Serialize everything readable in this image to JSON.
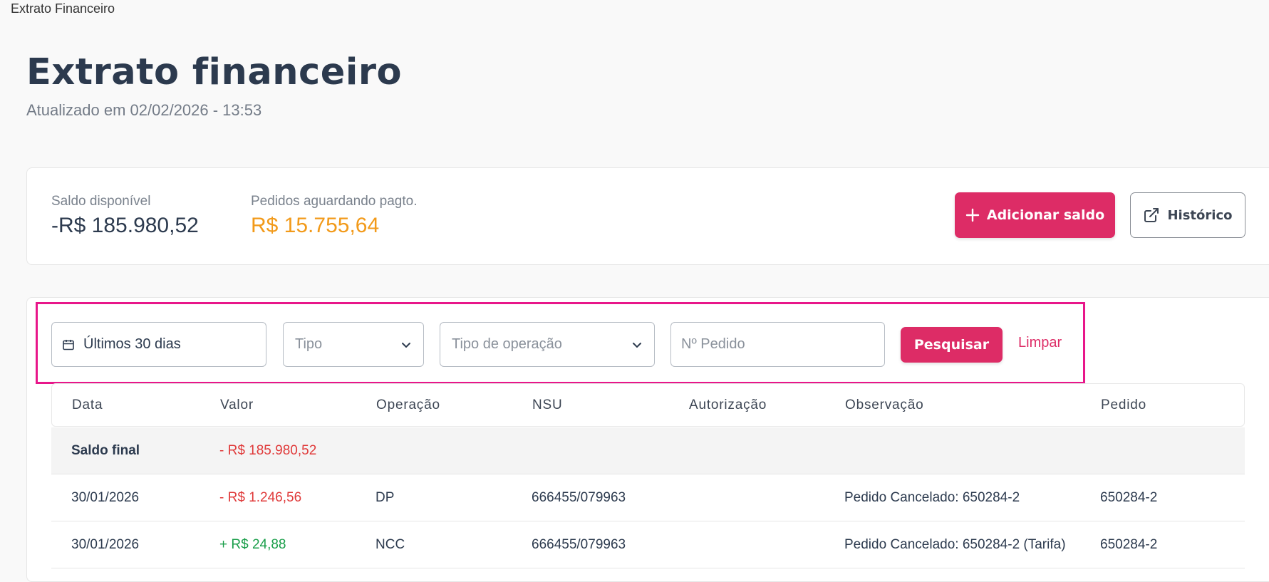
{
  "tab_title": "Extrato Financeiro",
  "page": {
    "title": "Extrato financeiro",
    "updated": "Atualizado em 02/02/2026 - 13:53"
  },
  "summary": {
    "balance_label": "Saldo disponível",
    "balance_value": "-R$ 185.980,52",
    "pending_label": "Pedidos aguardando pagto.",
    "pending_value": "R$ 15.755,64",
    "add_balance_label": "Adicionar saldo",
    "history_label": "Histórico"
  },
  "filters": {
    "date_value": "Últimos 30 dias",
    "type_placeholder": "Tipo",
    "operation_placeholder": "Tipo de operação",
    "order_placeholder": "Nº Pedido",
    "search_label": "Pesquisar",
    "clear_label": "Limpar"
  },
  "table": {
    "columns": [
      "Data",
      "Valor",
      "Operação",
      "NSU",
      "Autorização",
      "Observação",
      "Pedido"
    ],
    "final_row": {
      "label": "Saldo final",
      "value": "- R$ 185.980,52"
    },
    "rows": [
      {
        "date": "30/01/2026",
        "value": "- R$ 1.246,56",
        "operation": "DP",
        "nsu": "666455/079963",
        "authorization": "",
        "observation": "Pedido Cancelado: 650284-2",
        "order": "650284-2"
      },
      {
        "date": "30/01/2026",
        "value": "+ R$ 24,88",
        "operation": "NCC",
        "nsu": "666455/079963",
        "authorization": "",
        "observation": "Pedido Cancelado: 650284-2 (Tarifa)",
        "order": "650284-2"
      }
    ]
  },
  "colors": {
    "accent": "#dd2c66",
    "highlight": "#e8168a",
    "pending": "#f29a1a",
    "negative": "#e03a3a",
    "positive": "#1a9e4a"
  }
}
